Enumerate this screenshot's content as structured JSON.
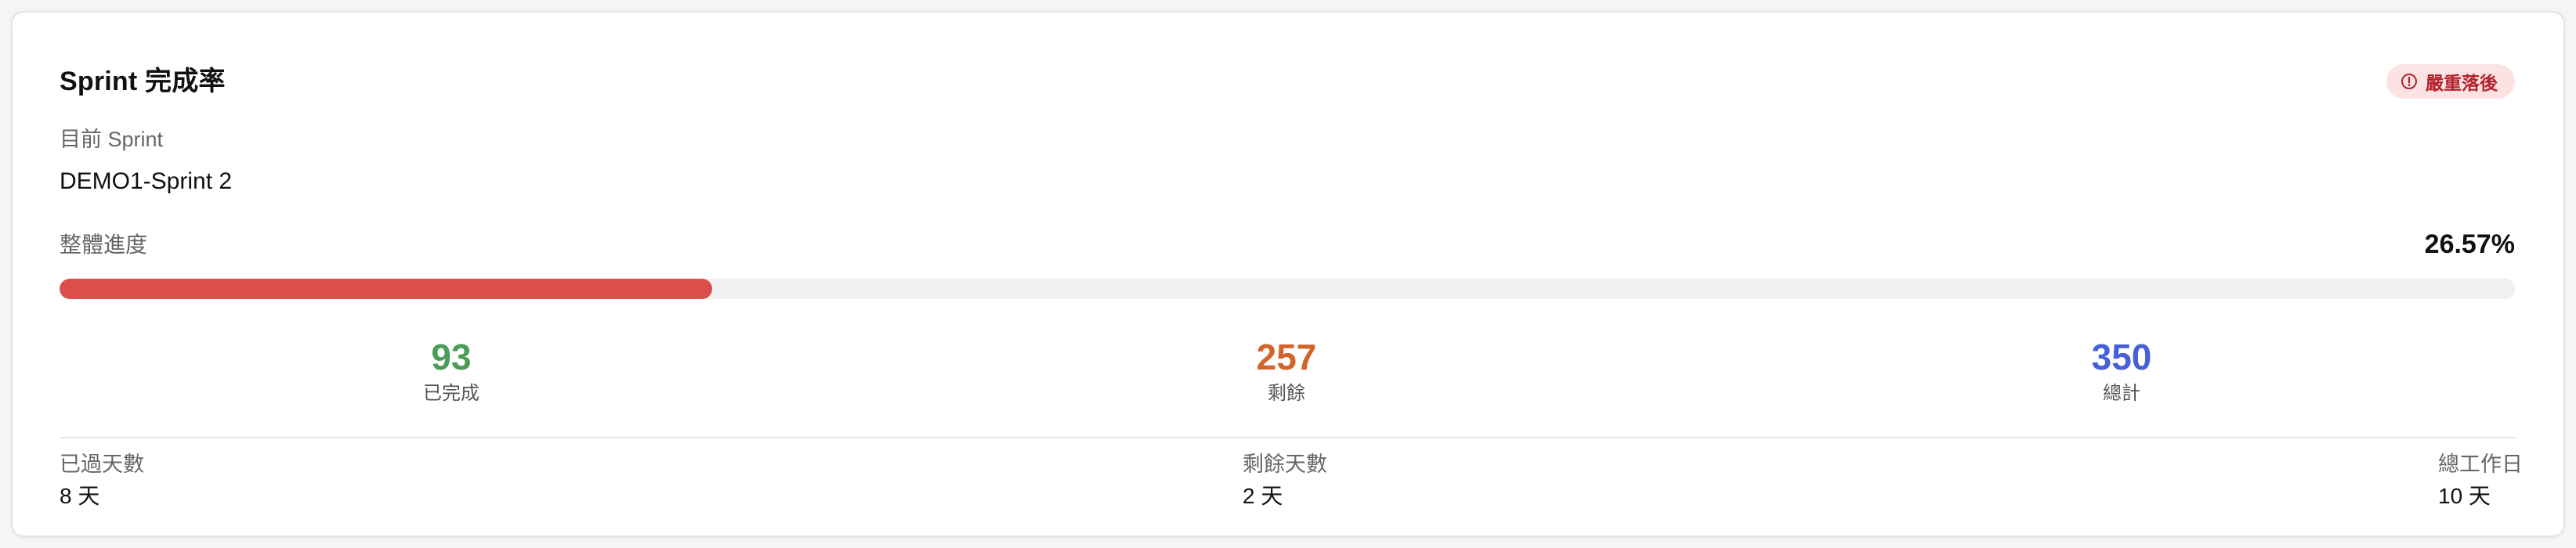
{
  "card": {
    "title": "Sprint 完成率",
    "status_badge": {
      "label": "嚴重落後",
      "icon": "alert-circle-icon",
      "background": "#fbe3e4",
      "color": "#b3222a"
    },
    "current_sprint_label": "目前 Sprint",
    "current_sprint_name": "DEMO1-Sprint 2"
  },
  "progress": {
    "label": "整體進度",
    "value_text": "26.57%",
    "fraction": 0.2657,
    "fill_color": "#dc4d4b",
    "track_color": "#f0f0f0"
  },
  "stats": [
    {
      "value": "93",
      "label": "已完成",
      "color": "#4a9d56"
    },
    {
      "value": "257",
      "label": "剩餘",
      "color": "#d4632a"
    },
    {
      "value": "350",
      "label": "總計",
      "color": "#4560d8"
    }
  ],
  "days": {
    "elapsed": {
      "label": "已過天數",
      "value": "8 天"
    },
    "remaining": {
      "label": "剩餘天數",
      "value": "2 天"
    },
    "total": {
      "label": "總工作日",
      "value": "10 天"
    }
  }
}
